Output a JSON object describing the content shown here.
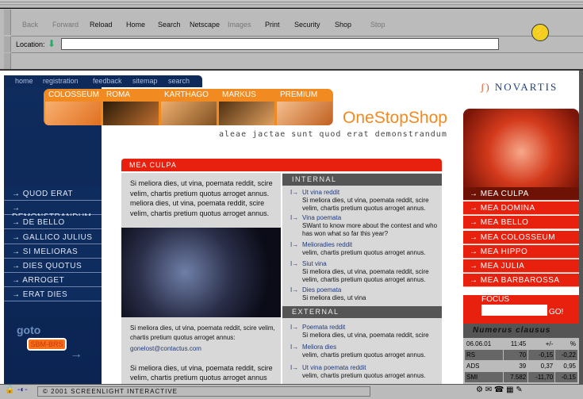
{
  "browser": {
    "toolbar": [
      "Back",
      "Forward",
      "Reload",
      "Home",
      "Search",
      "Netscape",
      "Images",
      "Print",
      "Security",
      "Shop",
      "Stop"
    ],
    "toolbar_disabled": [
      "Back",
      "Forward",
      "Images",
      "Stop"
    ],
    "location_label": "Location:",
    "location_value": "",
    "status": "© 2001 SCREENLIGHT INTERACTIVE"
  },
  "topnav": [
    "home",
    "registration",
    "feedback",
    "sitemap",
    "search"
  ],
  "tabs": [
    "COLOSSEUM",
    "ROMA",
    "KARTHAGO",
    "MARKUS",
    "PREMIUM"
  ],
  "brand": {
    "title": "OneStopShop",
    "tagline": "aleae jactae sunt quod erat demonstrandum",
    "logo": "NOVARTIS"
  },
  "left_menu": [
    "QUOD ERAT",
    "DEMONSTRANDUM",
    "DE BELLO",
    "GALLICO JULIUS",
    "SI MELIORAS",
    "DIES QUOTUS",
    "ARROGET",
    "ERAT DIES"
  ],
  "goto": {
    "prefix": "goto",
    "label": "SBM-BRS"
  },
  "main": {
    "header": "MEA CULPA",
    "intro": "Si meliora dies, ut vina, poemata reddit, scire velim, chartis pretium quotus arroget annus. meliora dies, ut vina, poemata reddit, scire velim, chartis pretium quotus arroget annus.",
    "caption": "Si meliora dies, ut vina, poemata reddit, scire velim, chartis pretium quotus arroget annus:",
    "email": "gonelost@contactus.com",
    "outro": "Si meliora dies, ut vina, poemata reddit, scire velim, chartis pretium quotus arroget annus"
  },
  "internal": {
    "title": "INTERNAL",
    "items": [
      {
        "title": "Ut vina reddit",
        "desc": "Si meliora dies, ut vina, poemata reddit, scire velim, chartis pretium quotus arroget annus."
      },
      {
        "title": "Vina poemata",
        "desc": "SWant to know more about the contest and who has won what so far this year?"
      },
      {
        "title": "Melioradies reddit",
        "desc": "velim, chartis pretium quotus arroget annus."
      },
      {
        "title": "Siut vina",
        "desc": "Si meliora dies, ut vina, poemata reddit, scire velim, chartis pretium quotus arroget annus."
      },
      {
        "title": "Dies poemata",
        "desc": "Si meliora dies, ut vina"
      }
    ]
  },
  "external": {
    "title": "EXTERNAL",
    "items": [
      {
        "title": "Poemata reddit",
        "desc": "Si meliora dies, ut vina, poemata reddit, scire"
      },
      {
        "title": "Meliora dies",
        "desc": "velim, chartis pretium quotus arroget annus."
      },
      {
        "title": "Ut vina poemata reddit",
        "desc": "velim, chartis pretium quotus arroget annus."
      }
    ]
  },
  "right_menu": {
    "items": [
      "MEA CULPA",
      "MEA DOMINA",
      "MEA BELLO",
      "MEA COLOSSEUM",
      "MEA HIPPO",
      "MEA JULIA",
      "MEA BARBAROSSA"
    ],
    "active": "MEA CULPA"
  },
  "focus": {
    "label": "FOCUS",
    "value": "",
    "go": "GO!"
  },
  "numerus": {
    "title": "Numerus clausus",
    "header": [
      "06.06.01",
      "11:45",
      "+/-",
      "%"
    ],
    "rows": [
      [
        "RS",
        "70",
        "-0,15",
        "-0,22"
      ],
      [
        "ADS",
        "39",
        "0,37",
        "0,95"
      ],
      [
        "SMI",
        "7.582",
        "-11,70",
        "-0,15"
      ]
    ]
  },
  "colors": {
    "navy": "#0f2c5e",
    "orange": "#f18a20",
    "red": "#e8200e"
  }
}
